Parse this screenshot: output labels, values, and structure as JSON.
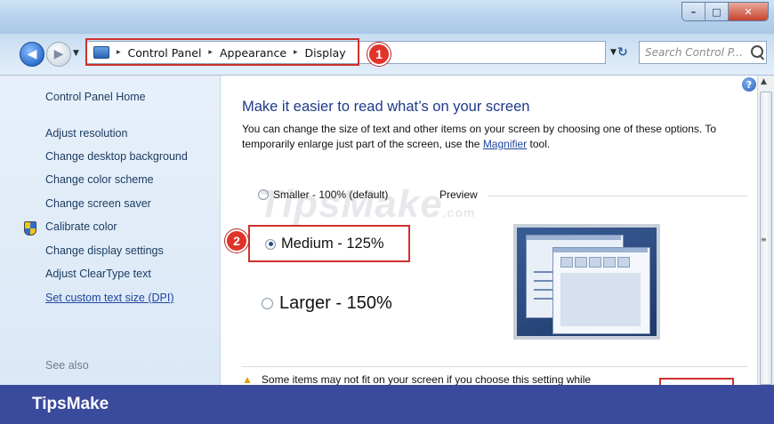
{
  "window": {
    "controls": {
      "minimize": "–",
      "maximize": "□",
      "close": "✕"
    }
  },
  "nav": {
    "back_icon": "back-arrow-icon",
    "forward_icon": "forward-arrow-icon"
  },
  "address": {
    "crumbs": [
      "Control Panel",
      "Appearance",
      "Display"
    ],
    "separator": "▸",
    "badge": "1"
  },
  "search": {
    "placeholder": "Search Control P..."
  },
  "sidebar": {
    "items": [
      {
        "label": "Control Panel Home"
      },
      {
        "label": "Adjust resolution"
      },
      {
        "label": "Change desktop background"
      },
      {
        "label": "Change color scheme"
      },
      {
        "label": "Change screen saver"
      },
      {
        "label": "Calibrate color"
      },
      {
        "label": "Change display settings"
      },
      {
        "label": "Adjust ClearType text"
      },
      {
        "label": "Set custom text size (DPI)"
      }
    ],
    "see_also": "See also"
  },
  "main": {
    "heading": "Make it easier to read what’s on your screen",
    "desc_before": "You can change the size of text and other items on your screen by choosing one of these options. To temporarily enlarge just part of the screen, use the ",
    "desc_link": "Magnifier",
    "desc_after": " tool.",
    "options": {
      "small": "Smaller - 100% (default)",
      "medium": "Medium - 125%",
      "large": "Larger - 150%",
      "selected": "medium"
    },
    "preview_label": "Preview",
    "badge": "2",
    "warning": "Some items may not fit on your screen if you choose this setting while"
  },
  "watermark": {
    "main": "TipsMake",
    "suffix": ".com"
  },
  "brand": {
    "name": "TipsMake"
  },
  "colors": {
    "highlight": "#d0302c",
    "brand_bar": "#3a4a9c",
    "link": "#1f46a0"
  }
}
